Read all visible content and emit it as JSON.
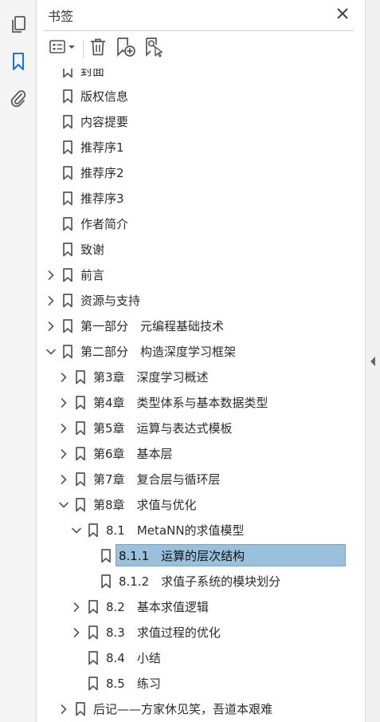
{
  "rail": {
    "items": [
      {
        "name": "pages-icon"
      },
      {
        "name": "bookmark-icon"
      },
      {
        "name": "attachment-icon"
      }
    ],
    "active_color": "#1473e6"
  },
  "panel": {
    "title": "书签",
    "toolbar": [
      "options-menu-icon",
      "delete-icon",
      "new-bookmark-icon",
      "bookmark-search-icon"
    ]
  },
  "tree": {
    "selected_color": "#99c1dc",
    "rows": [
      {
        "label": "封面",
        "level": 0,
        "expander": "none"
      },
      {
        "label": "版权信息",
        "level": 0,
        "expander": "none"
      },
      {
        "label": "内容提要",
        "level": 0,
        "expander": "none"
      },
      {
        "label": "推荐序1",
        "level": 0,
        "expander": "none"
      },
      {
        "label": "推荐序2",
        "level": 0,
        "expander": "none"
      },
      {
        "label": "推荐序3",
        "level": 0,
        "expander": "none"
      },
      {
        "label": "作者简介",
        "level": 0,
        "expander": "none"
      },
      {
        "label": "致谢",
        "level": 0,
        "expander": "none"
      },
      {
        "label": "前言",
        "level": 0,
        "expander": "collapsed"
      },
      {
        "label": "资源与支持",
        "level": 0,
        "expander": "collapsed"
      },
      {
        "label": "第一部分　元编程基础技术",
        "level": 0,
        "expander": "collapsed"
      },
      {
        "label": "第二部分　构造深度学习框架",
        "level": 0,
        "expander": "expanded"
      },
      {
        "label": "第3章　深度学习概述",
        "level": 1,
        "expander": "collapsed"
      },
      {
        "label": "第4章　类型体系与基本数据类型",
        "level": 1,
        "expander": "collapsed"
      },
      {
        "label": "第5章　运算与表达式模板",
        "level": 1,
        "expander": "collapsed"
      },
      {
        "label": "第6章　基本层",
        "level": 1,
        "expander": "collapsed"
      },
      {
        "label": "第7章　复合层与循环层",
        "level": 1,
        "expander": "collapsed"
      },
      {
        "label": "第8章　求值与优化",
        "level": 1,
        "expander": "expanded"
      },
      {
        "label": "8.1　MetaNN的求值模型",
        "level": 2,
        "expander": "expanded"
      },
      {
        "label": "8.1.1　运算的层次结构",
        "level": 3,
        "expander": "none",
        "selected": true
      },
      {
        "label": "8.1.2　求值子系统的模块划分",
        "level": 3,
        "expander": "none"
      },
      {
        "label": "8.2　基本求值逻辑",
        "level": 2,
        "expander": "collapsed"
      },
      {
        "label": "8.3　求值过程的优化",
        "level": 2,
        "expander": "collapsed"
      },
      {
        "label": "8.4　小结",
        "level": 2,
        "expander": "none"
      },
      {
        "label": "8.5　练习",
        "level": 2,
        "expander": "none"
      },
      {
        "label": "后记——方家休见笑，吾道本艰难",
        "level": 1,
        "expander": "collapsed"
      }
    ]
  }
}
